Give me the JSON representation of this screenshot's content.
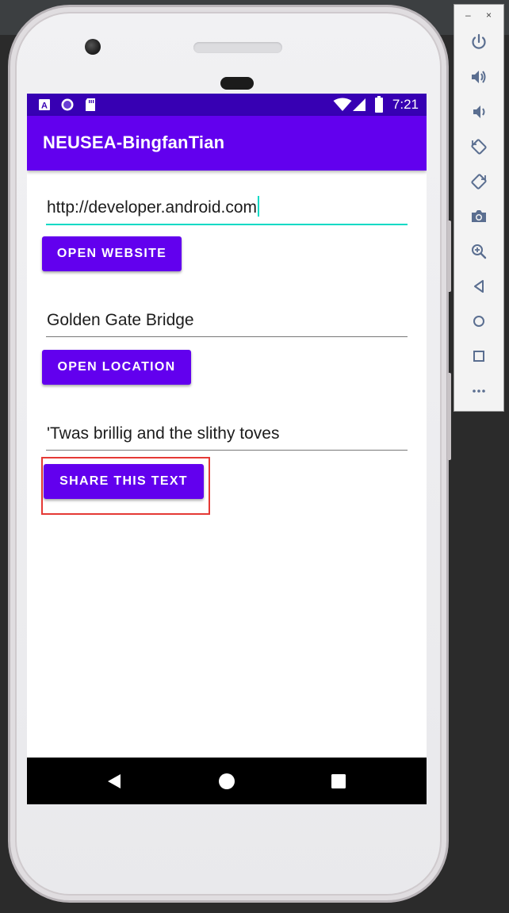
{
  "status_bar": {
    "time": "7:21",
    "left_icons": [
      "a-notification-icon",
      "circle-notification-icon",
      "sdcard-icon"
    ],
    "right_icons": [
      "wifi-icon",
      "signal-icon",
      "battery-icon"
    ]
  },
  "app_bar": {
    "title": "NEUSEA-BingfanTian"
  },
  "website": {
    "value": "http://developer.android.com",
    "button_label": "OPEN WEBSITE"
  },
  "location": {
    "value": "Golden Gate Bridge",
    "button_label": "OPEN LOCATION"
  },
  "share": {
    "value": "'Twas brillig and the slithy toves",
    "button_label": "SHARE THIS TEXT"
  },
  "nav_bar": {
    "buttons": [
      "back-icon",
      "home-icon",
      "recents-icon"
    ]
  },
  "emulator_panel": {
    "window_controls": [
      "minimize-icon",
      "close-icon"
    ],
    "buttons": [
      "power-icon",
      "volume-up-icon",
      "volume-down-icon",
      "rotate-left-icon",
      "rotate-right-icon",
      "camera-icon",
      "zoom-icon",
      "back-icon",
      "home-icon",
      "overview-icon",
      "more-icon"
    ]
  },
  "colors": {
    "status_bar": "#3700b3",
    "app_bar": "#6200ee",
    "button": "#6200ee",
    "focus_accent": "#03dac5",
    "highlight_box": "#e53935"
  }
}
